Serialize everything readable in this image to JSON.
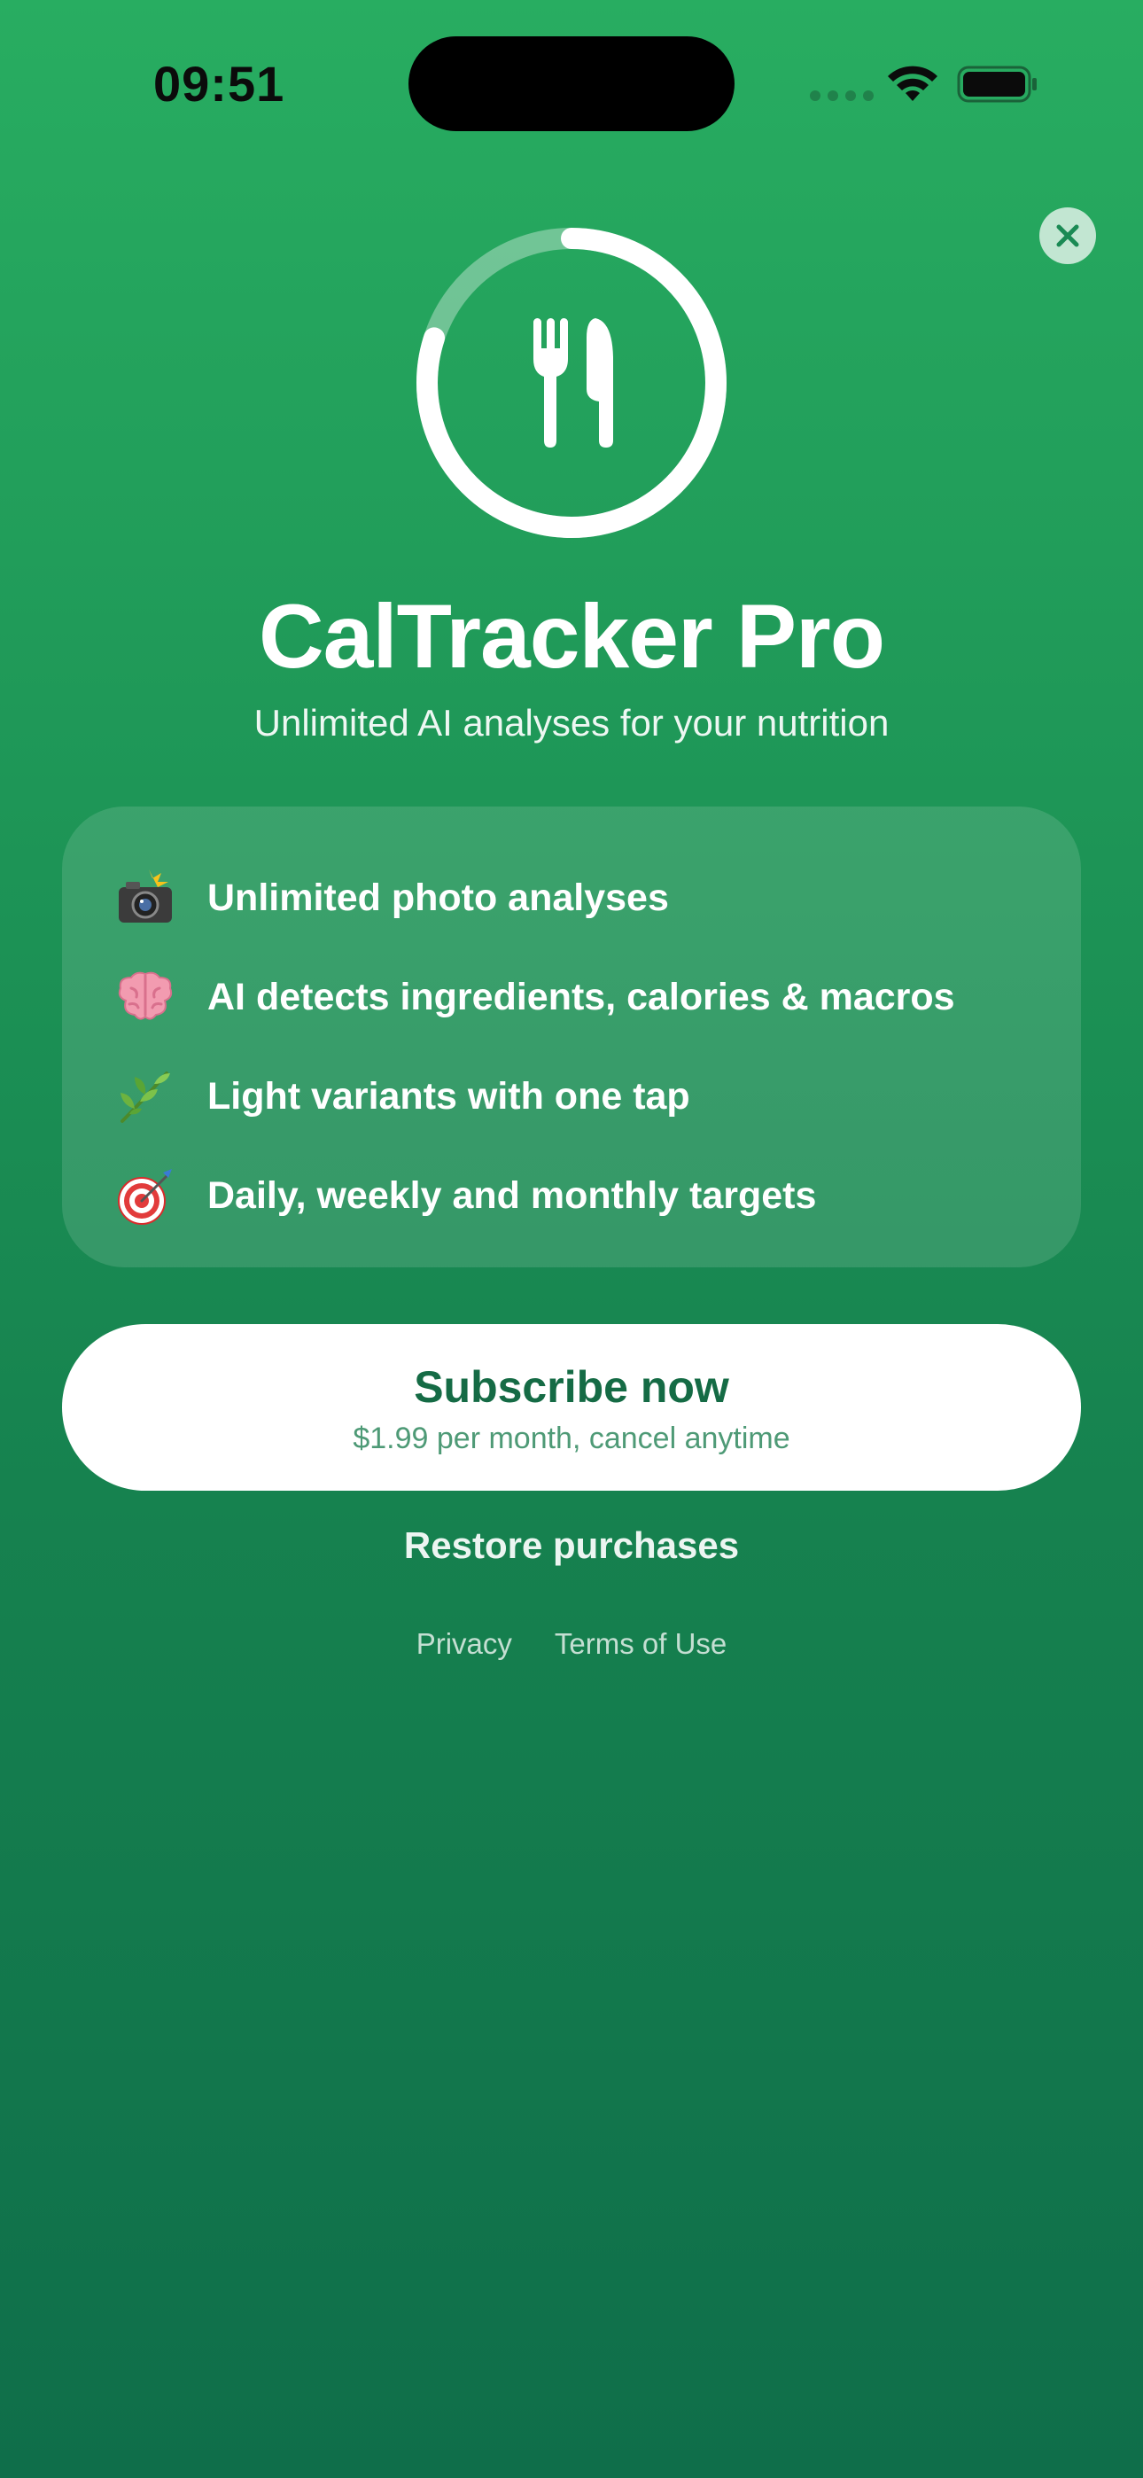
{
  "status_bar": {
    "time": "09:51"
  },
  "close_button": {
    "icon": "close-icon"
  },
  "logo": {
    "icon": "fork-knife-icon",
    "ring_progress": 0.8
  },
  "app": {
    "title": "CalTracker Pro",
    "subtitle": "Unlimited AI analyses for your nutrition"
  },
  "features": [
    {
      "icon": "camera-flash-icon",
      "label": "Unlimited photo analyses"
    },
    {
      "icon": "brain-icon",
      "label": "AI detects ingredients, calories & macros"
    },
    {
      "icon": "herb-icon",
      "label": "Light variants with one tap"
    },
    {
      "icon": "target-icon",
      "label": "Daily, weekly and monthly targets"
    }
  ],
  "subscribe": {
    "label": "Subscribe now",
    "price": "$1.99 per month, cancel anytime"
  },
  "restore_label": "Restore purchases",
  "footer": {
    "privacy": "Privacy",
    "terms": "Terms of Use"
  },
  "colors": {
    "background_top": "#28ad61",
    "background_bottom": "#0f6e4a",
    "accent_dark_green": "#156b45"
  }
}
